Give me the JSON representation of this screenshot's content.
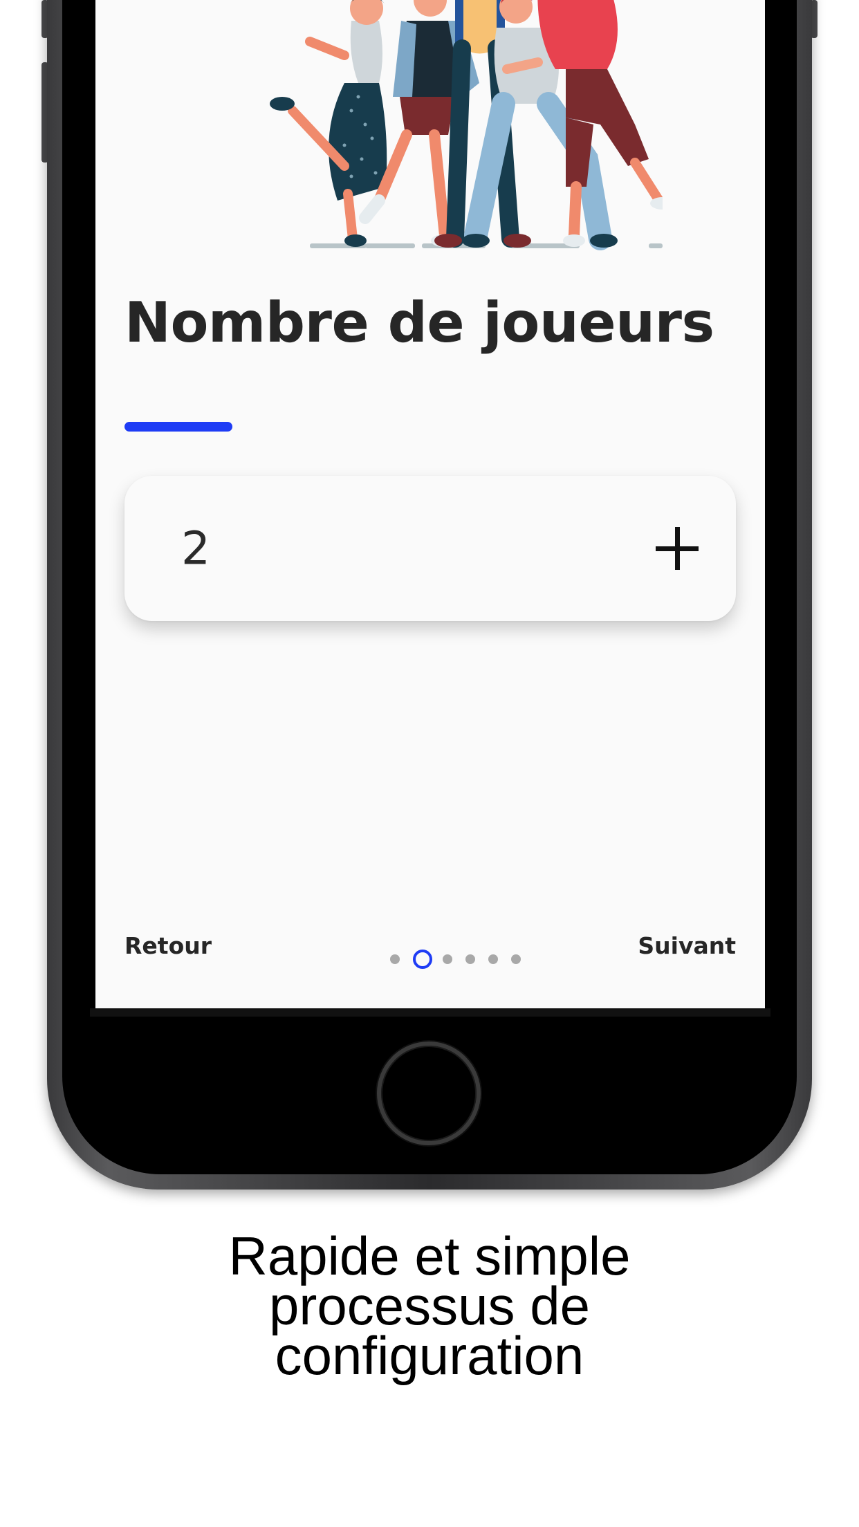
{
  "screen": {
    "title": "Nombre de joueurs",
    "accent_color": "#1e3cf5",
    "counter": {
      "value": "2",
      "increment_icon": "plus-icon"
    },
    "navigation": {
      "back_label": "Retour",
      "next_label": "Suivant",
      "pager": {
        "total_pages": 6,
        "current_page": 2
      }
    }
  },
  "caption": {
    "lines": [
      "Rapide et simple",
      "processus de",
      "configuration"
    ]
  }
}
